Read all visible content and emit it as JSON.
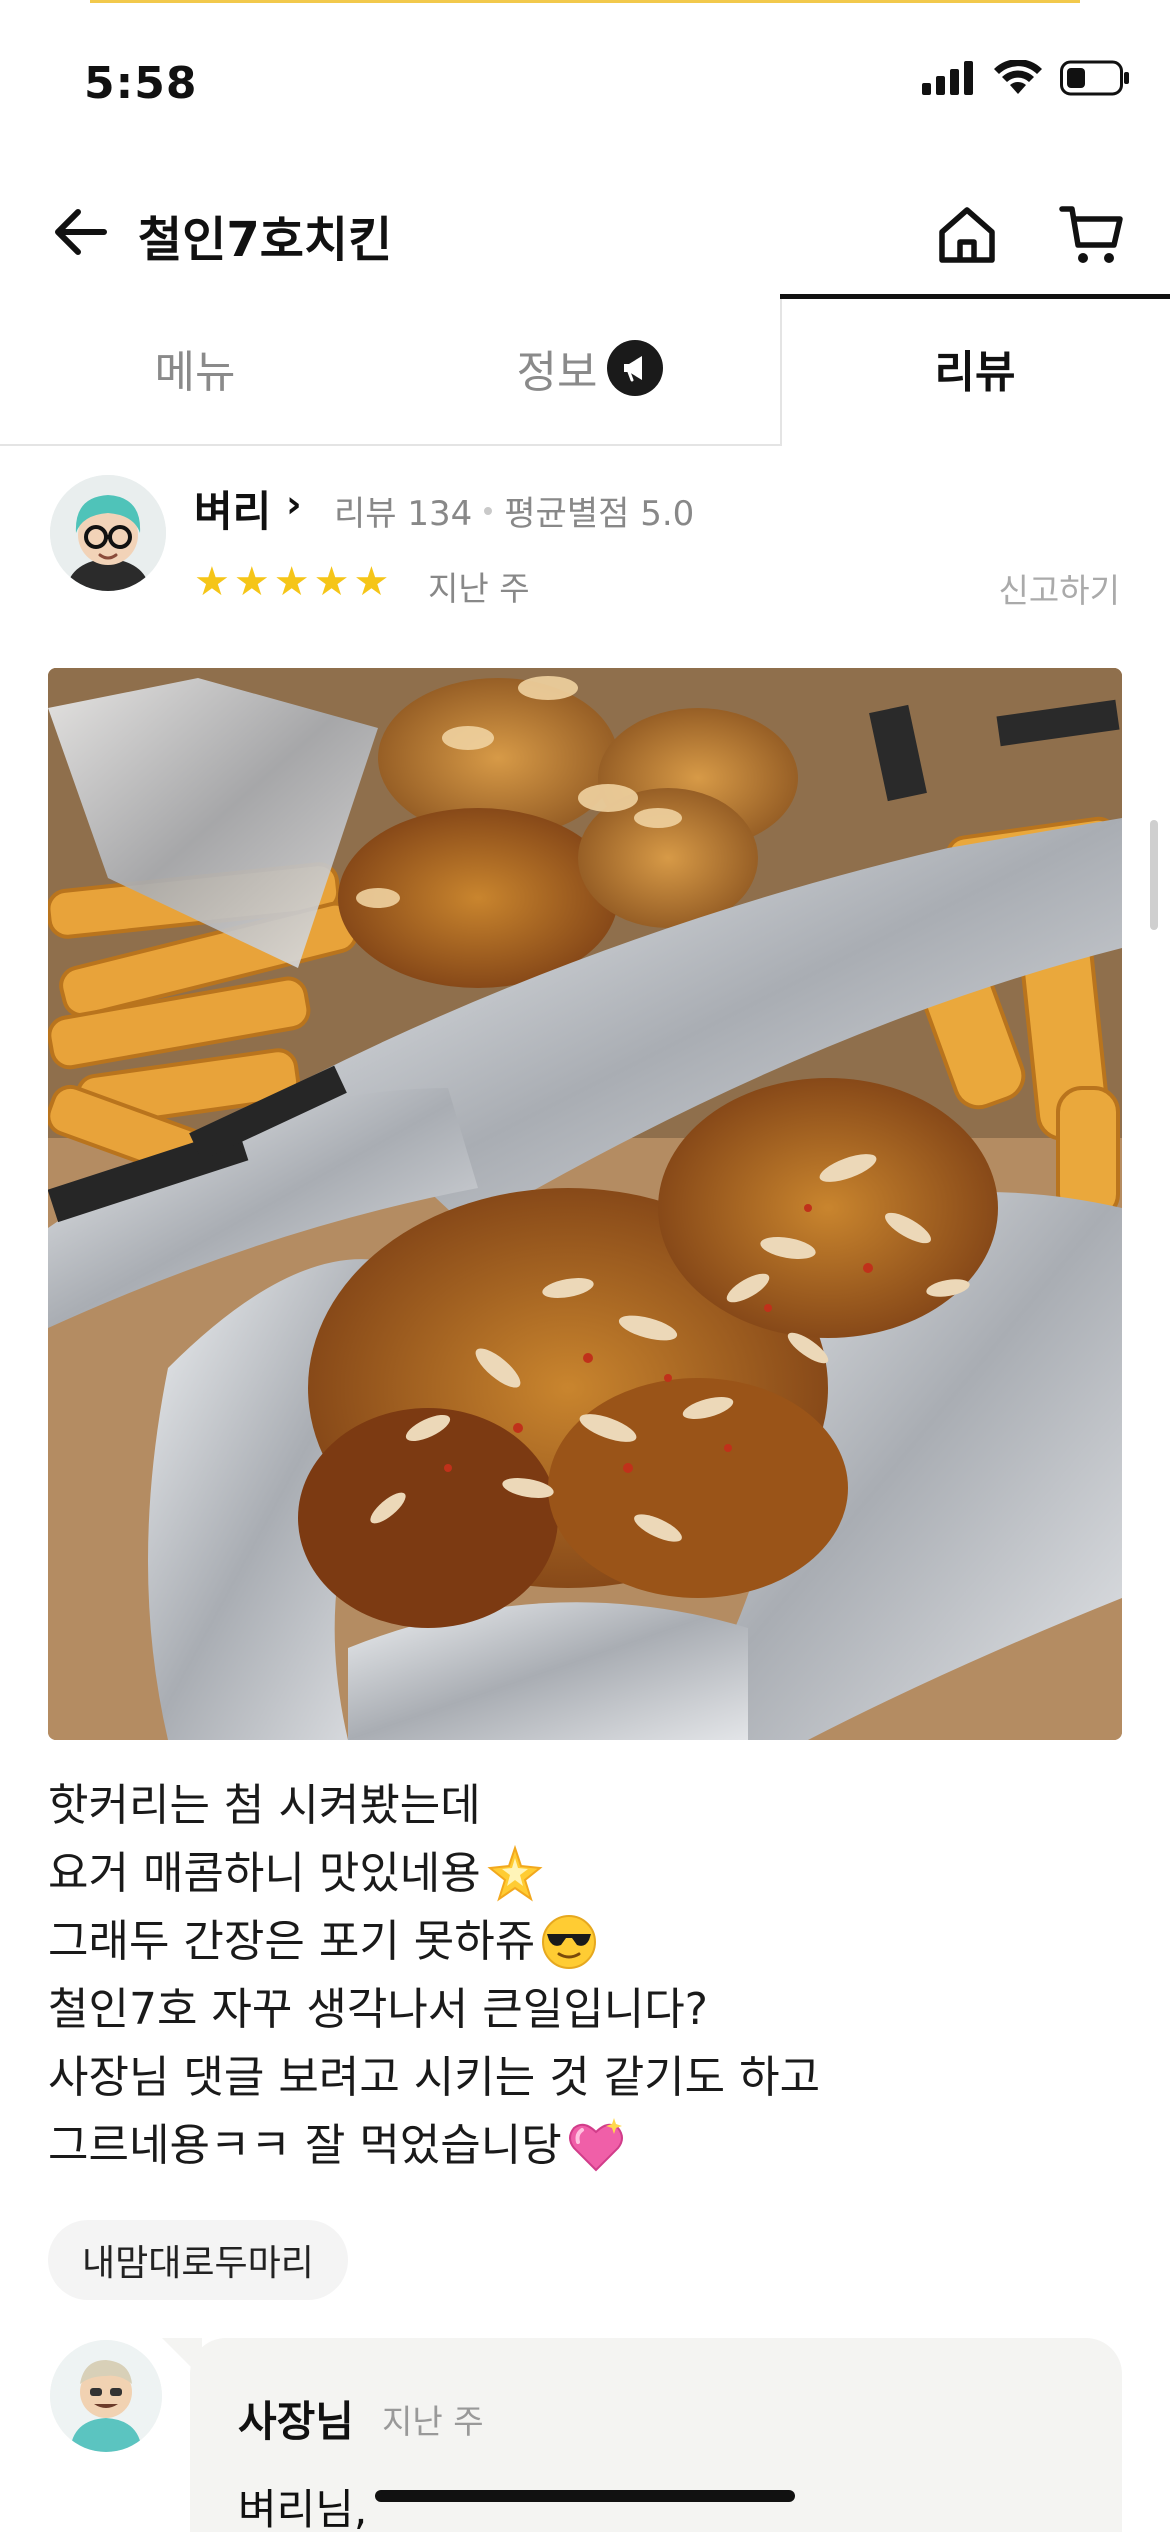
{
  "status_bar": {
    "time": "5:58"
  },
  "header": {
    "title": "철인7호치킨"
  },
  "tabs": [
    {
      "label": "메뉴",
      "active": false
    },
    {
      "label": "정보",
      "active": false
    },
    {
      "label": "리뷰",
      "active": true
    }
  ],
  "review": {
    "reviewer_name": "벼리",
    "review_count_label": "리뷰 134",
    "avg_rating_label": "평균별점 5.0",
    "rating": 5,
    "date": "지난 주",
    "report_label": "신고하기",
    "lines": [
      {
        "text": "핫커리는 첨 시켜봤는데",
        "emoji": ""
      },
      {
        "text": "요거 매콤하니 맛있네용",
        "emoji": "sparkle-star"
      },
      {
        "text": "그래두 간장은 포기 못하쥬",
        "emoji": "sunglasses-face"
      },
      {
        "text": "철인7호 자꾸 생각나서 큰일입니다?",
        "emoji": ""
      },
      {
        "text": "사장님 댓글 보려고 시키는 것 같기도 하고",
        "emoji": ""
      },
      {
        "text": "그르네용ㅋㅋ 잘 먹었습니당",
        "emoji": "sparkling-heart"
      }
    ],
    "menu_chip": "내맘대로두마리"
  },
  "owner_reply": {
    "name": "사장님",
    "date": "지난 주",
    "text": "벼리님,"
  },
  "colors": {
    "star": "#f5c518",
    "accent_yellow": "#f2c94c",
    "reply_bg": "#f4f4f2"
  }
}
